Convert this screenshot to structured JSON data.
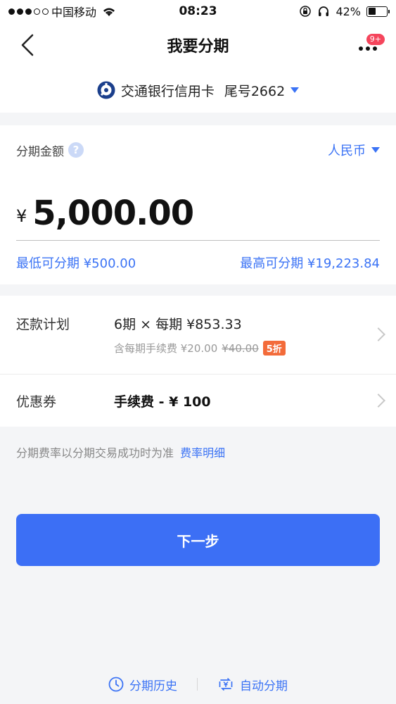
{
  "status_bar": {
    "carrier": "中国移动",
    "time": "08:23",
    "battery": "42%",
    "battery_level": 0.42
  },
  "nav": {
    "title": "我要分期",
    "badge": "9+"
  },
  "card": {
    "name": "交通银行信用卡",
    "tail": "尾号2662"
  },
  "amount": {
    "label": "分期金额",
    "help": "?",
    "currency": "人民币",
    "symbol": "¥",
    "value": "5,000.00",
    "min": "最低可分期 ¥500.00",
    "max": "最高可分期 ¥19,223.84"
  },
  "plan": {
    "label": "还款计划",
    "value": "6期 × 每期 ¥853.33",
    "fee_prefix": "含每期手续费 ¥20.00",
    "fee_original": "¥40.00",
    "discount": "5折"
  },
  "coupon": {
    "label": "优惠券",
    "value": "手续费 - ¥ 100"
  },
  "note": {
    "text": "分期费率以分期交易成功时为准",
    "link": "费率明细"
  },
  "next_button": "下一步",
  "footer": {
    "history": "分期历史",
    "auto": "自动分期"
  },
  "colors": {
    "accent": "#3c6ff5",
    "discount": "#f36b3a",
    "badge": "#f5455c"
  }
}
